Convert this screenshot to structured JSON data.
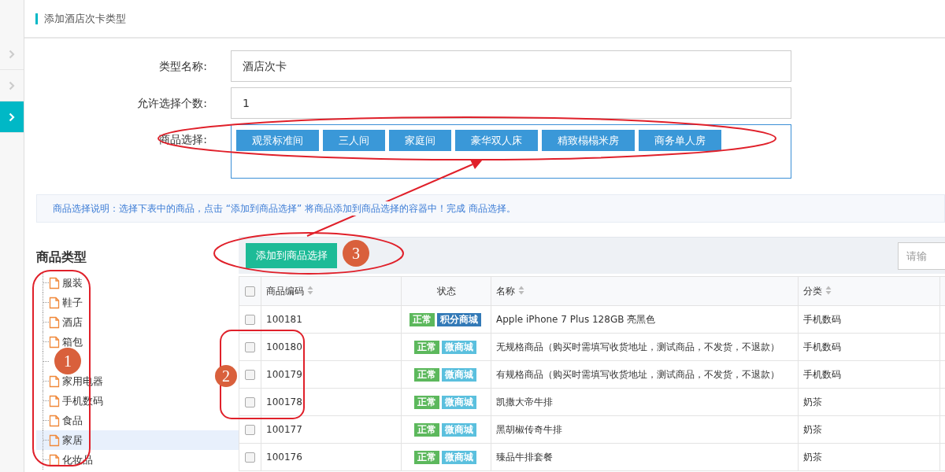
{
  "page": {
    "title": "添加酒店次卡类型"
  },
  "sidebar": {
    "items": [
      {
        "selected": false
      },
      {
        "selected": false
      },
      {
        "selected": true
      }
    ]
  },
  "form": {
    "fields": [
      {
        "label": "类型名称:",
        "value": "酒店次卡"
      },
      {
        "label": "允许选择个数:",
        "value": "1"
      }
    ],
    "selection": {
      "label": "商品选择:",
      "chips": [
        "观景标准间",
        "三人间",
        "家庭间",
        "豪华双人床",
        "精致榻榻米房",
        "商务单人房"
      ]
    }
  },
  "notice": {
    "text": "商品选择说明：选择下表中的商品，点击 “添加到商品选择” 将商品添加到商品选择的容器中！完成 商品选择。"
  },
  "category_tree": {
    "title": "商品类型",
    "items": [
      {
        "label": "服装",
        "selected": false
      },
      {
        "label": "鞋子",
        "selected": false
      },
      {
        "label": "酒店",
        "selected": false
      },
      {
        "label": "箱包",
        "selected": false
      },
      {
        "selected": false
      },
      {
        "label": "家用电器",
        "selected": false
      },
      {
        "label": "手机数码",
        "selected": false
      },
      {
        "label": "食品",
        "selected": false
      },
      {
        "label": "家居",
        "selected": true
      },
      {
        "label": "化妆品",
        "selected": false
      }
    ]
  },
  "toolbar": {
    "add_button": "添加到商品选择",
    "search": {
      "placeholder": "请输"
    }
  },
  "table": {
    "header_checked": false,
    "columns": [
      {
        "label": "商品编码",
        "sortable": true
      },
      {
        "label": "状态",
        "sortable": false
      },
      {
        "label": "名称",
        "sortable": true
      },
      {
        "label": "分类",
        "sortable": true
      }
    ],
    "rows": [
      {
        "checked": false,
        "code": "100181",
        "tags": [
          {
            "text": "正常",
            "color": "#5cb85c"
          },
          {
            "text": "积分商城",
            "color": "#337ab7"
          }
        ],
        "name": "Apple iPhone 7 Plus 128GB 亮黑色",
        "category": "手机数码"
      },
      {
        "checked": false,
        "code": "100180",
        "tags": [
          {
            "text": "正常",
            "color": "#5cb85c"
          },
          {
            "text": "微商城",
            "color": "#5bc0de"
          }
        ],
        "name": "无规格商品（购买时需填写收货地址，测试商品，不发货，不退款）",
        "category": "手机数码"
      },
      {
        "checked": false,
        "code": "100179",
        "tags": [
          {
            "text": "正常",
            "color": "#5cb85c"
          },
          {
            "text": "微商城",
            "color": "#5bc0de"
          }
        ],
        "name": "有规格商品（购买时需填写收货地址，测试商品，不发货，不退款）",
        "category": "手机数码"
      },
      {
        "checked": false,
        "code": "100178",
        "tags": [
          {
            "text": "正常",
            "color": "#5cb85c"
          },
          {
            "text": "微商城",
            "color": "#5bc0de"
          }
        ],
        "name": "凯撒大帝牛排",
        "category": "奶茶"
      },
      {
        "checked": false,
        "code": "100177",
        "tags": [
          {
            "text": "正常",
            "color": "#5cb85c"
          },
          {
            "text": "微商城",
            "color": "#5bc0de"
          }
        ],
        "name": "黑胡椒传奇牛排",
        "category": "奶茶"
      },
      {
        "checked": false,
        "code": "100176",
        "tags": [
          {
            "text": "正常",
            "color": "#5cb85c"
          },
          {
            "text": "微商城",
            "color": "#5bc0de"
          }
        ],
        "name": "臻品牛排套餐",
        "category": "奶茶"
      }
    ]
  },
  "annotations": {
    "markers": [
      {
        "number": "1"
      },
      {
        "number": "2"
      },
      {
        "number": "3"
      }
    ]
  }
}
